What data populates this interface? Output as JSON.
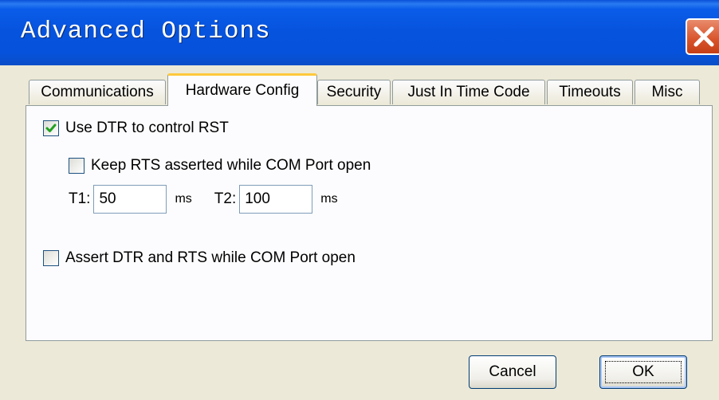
{
  "window": {
    "title": "Advanced Options"
  },
  "tabs": [
    {
      "label": "Communications",
      "active": false
    },
    {
      "label": "Hardware Config",
      "active": true
    },
    {
      "label": "Security",
      "active": false
    },
    {
      "label": "Just In Time Code",
      "active": false
    },
    {
      "label": "Timeouts",
      "active": false
    },
    {
      "label": "Misc",
      "active": false
    }
  ],
  "hardware": {
    "use_dtr": {
      "label": "Use DTR to control RST",
      "checked": true
    },
    "keep_rts": {
      "label": "Keep RTS asserted while COM Port open",
      "checked": false
    },
    "t1": {
      "label": "T1:",
      "value": "50",
      "unit": "ms"
    },
    "t2": {
      "label": "T2:",
      "value": "100",
      "unit": "ms"
    },
    "assert_dtr_rts": {
      "label": "Assert DTR and RTS while COM Port open",
      "checked": false
    }
  },
  "buttons": {
    "cancel": "Cancel",
    "ok": "OK"
  },
  "colors": {
    "titlebar": "#0653dd",
    "face": "#ece9d8",
    "active_tab_accent": "#ffc83c",
    "check": "#21a121"
  }
}
